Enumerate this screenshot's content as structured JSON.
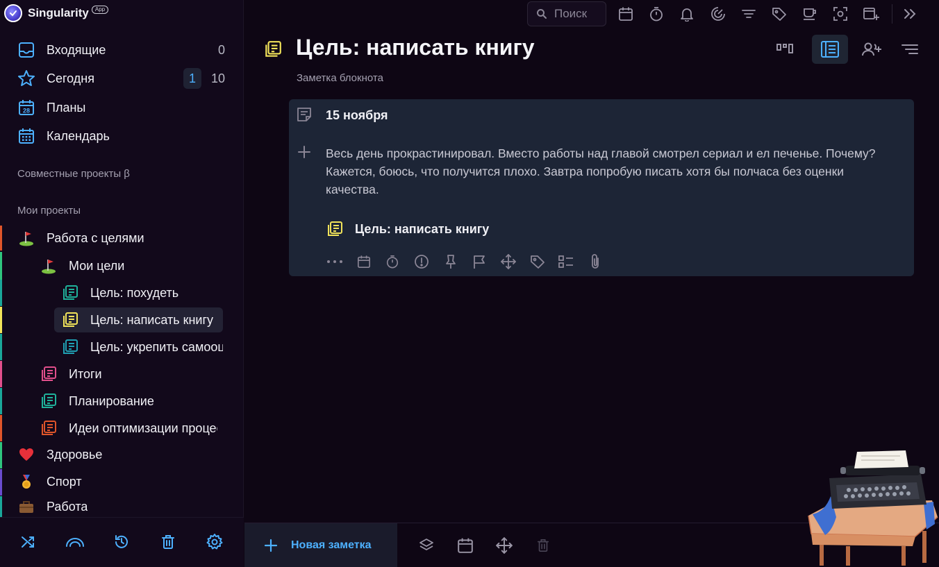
{
  "brand": {
    "title": "Singularity",
    "badge": "App"
  },
  "nav": [
    {
      "label": "Входящие",
      "count": "0"
    },
    {
      "label": "Сегодня",
      "accent_count": "1",
      "count": "10"
    },
    {
      "label": "Планы",
      "icon_day": "28"
    },
    {
      "label": "Календарь"
    }
  ],
  "sections": {
    "shared": "Совместные проекты β",
    "my": "Мои проекты"
  },
  "tree": [
    {
      "label": "Работа с целями",
      "icon": "golf-flag-icon"
    },
    {
      "label": "Мои цели",
      "icon": "golf-flag-icon"
    },
    {
      "label": "Цель: похудеть",
      "icon": "notebook-icon"
    },
    {
      "label": "Цель: написать книгу",
      "icon": "notebook-icon",
      "active": true
    },
    {
      "label": "Цель: укрепить самооценку",
      "icon": "notebook-icon"
    },
    {
      "label": "Итоги",
      "icon": "notebook-icon"
    },
    {
      "label": "Планирование",
      "icon": "notebook-icon"
    },
    {
      "label": "Идеи оптимизации процессов",
      "icon": "notebook-icon"
    },
    {
      "label": "Здоровье",
      "icon": "heart-icon"
    },
    {
      "label": "Спорт",
      "icon": "medal-icon"
    },
    {
      "label": "Работа",
      "icon": "briefcase-icon"
    }
  ],
  "colors": {
    "accent": "#4db1ff",
    "edge_orange": "#e0552a",
    "edge_green": "#2fc57e",
    "edge_teal": "#1aa79a",
    "edge_yellow": "#f2e45a",
    "edge_pink": "#e24f8c",
    "edge_red": "#e0552a",
    "edge_purple": "#6a4ccf"
  },
  "search": {
    "placeholder": "Поиск"
  },
  "header": {
    "title": "Цель: написать книгу",
    "subtitle": "Заметка блокнота"
  },
  "note": {
    "date": "15 ноября",
    "body": "Весь день прокрастинировал. Вместо работы над главой смотрел сериал и ел печенье. Почему? Кажется, боюсь, что получится плохо. Завтра попробую писать хотя бы полчаса без оценки качества.",
    "link_label": "Цель: написать книгу"
  },
  "bottom": {
    "new_note": "Новая заметка"
  }
}
